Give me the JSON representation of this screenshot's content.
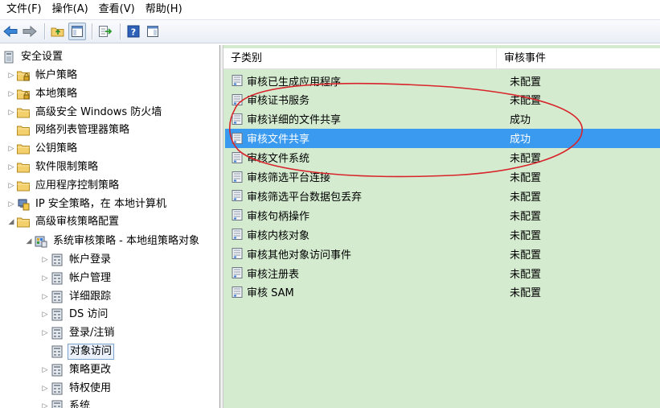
{
  "menu": [
    {
      "label": "文件(F)"
    },
    {
      "label": "操作(A)"
    },
    {
      "label": "查看(V)"
    },
    {
      "label": "帮助(H)"
    }
  ],
  "tree": {
    "root": "安全设置",
    "items": [
      {
        "label": "帐户策略",
        "arrow": "▷",
        "icon": "folder-lock-icon"
      },
      {
        "label": "本地策略",
        "arrow": "▷",
        "icon": "folder-lock-icon"
      },
      {
        "label": "高级安全 Windows 防火墙",
        "arrow": "▷",
        "icon": "folder-icon"
      },
      {
        "label": "网络列表管理器策略",
        "arrow": "",
        "icon": "folder-icon"
      },
      {
        "label": "公钥策略",
        "arrow": "▷",
        "icon": "folder-icon"
      },
      {
        "label": "软件限制策略",
        "arrow": "▷",
        "icon": "folder-icon"
      },
      {
        "label": "应用程序控制策略",
        "arrow": "▷",
        "icon": "folder-icon"
      },
      {
        "label": "IP 安全策略，在 本地计算机",
        "arrow": "▷",
        "icon": "ip-security-icon"
      },
      {
        "label": "高级审核策略配置",
        "arrow": "◢",
        "icon": "folder-icon"
      }
    ],
    "policy_object": "系统审核策略 - 本地组策略对象",
    "categories": [
      {
        "label": "帐户登录",
        "arrow": "▷"
      },
      {
        "label": "帐户管理",
        "arrow": "▷"
      },
      {
        "label": "详细跟踪",
        "arrow": "▷"
      },
      {
        "label": "DS 访问",
        "arrow": "▷"
      },
      {
        "label": "登录/注销",
        "arrow": "▷"
      },
      {
        "label": "对象访问",
        "arrow": "",
        "selected": true
      },
      {
        "label": "策略更改",
        "arrow": "▷"
      },
      {
        "label": "特权使用",
        "arrow": "▷"
      },
      {
        "label": "系统",
        "arrow": "▷"
      }
    ]
  },
  "list": {
    "columns": [
      "子类别",
      "审核事件"
    ],
    "rows": [
      {
        "name": "审核已生成应用程序",
        "status": "未配置"
      },
      {
        "name": "审核证书服务",
        "status": "未配置"
      },
      {
        "name": "审核详细的文件共享",
        "status": "成功"
      },
      {
        "name": "审核文件共享",
        "status": "成功",
        "selected": true
      },
      {
        "name": "审核文件系统",
        "status": "未配置"
      },
      {
        "name": "审核筛选平台连接",
        "status": "未配置"
      },
      {
        "name": "审核筛选平台数据包丢弃",
        "status": "未配置"
      },
      {
        "name": "审核句柄操作",
        "status": "未配置"
      },
      {
        "name": "审核内核对象",
        "status": "未配置"
      },
      {
        "name": "审核其他对象访问事件",
        "status": "未配置"
      },
      {
        "name": "审核注册表",
        "status": "未配置"
      },
      {
        "name": "审核 SAM",
        "status": "未配置"
      }
    ]
  },
  "colors": {
    "list_background": "#d4ebd0",
    "selection": "#3a9af0",
    "annotation": "#d8242a"
  }
}
